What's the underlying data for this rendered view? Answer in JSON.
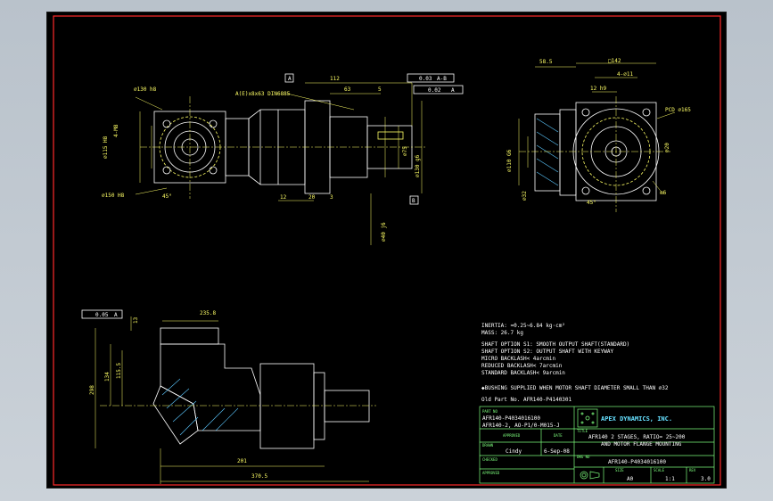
{
  "drawing": {
    "front_view": {
      "dims": {
        "d1": "⌀130 h8",
        "d2": "4-M8",
        "d3": "⌀115 H8",
        "d4": "⌀150 H8",
        "angle": "45°",
        "thread": "A(E)x8x63 DIN6885",
        "len1": "112",
        "len2": "63",
        "len3": "5",
        "len4": "12",
        "len5": "20",
        "len6": "3",
        "shaft1": "⌀75",
        "shaft2": "⌀130 g6",
        "shaft3": "⌀40 j6",
        "tol1": "0.03",
        "tol1_ref": "A-B",
        "tol2": "0.02",
        "tol2_ref": "A",
        "datum_a": "A",
        "datum_b": "B"
      }
    },
    "side_view": {
      "dims": {
        "s1": "58.5",
        "s2": "□142",
        "s3": "4-⌀11",
        "s4": "12 h9",
        "s5": "PCD ⌀165",
        "s6": "⌀110 G6",
        "s7": "⌀32",
        "s8": "⌀20",
        "s9": "45°",
        "s10": "⌀6"
      }
    },
    "bottom_view": {
      "dims": {
        "b1": "0.05",
        "b1_ref": "A",
        "b2": "235.8",
        "b3": "134",
        "b4": "115.5",
        "b5": "201",
        "b6": "370.5",
        "b7": "298",
        "b8": "13"
      }
    },
    "notes": [
      "INERTIA:   ≈0.25~6.84 kg·cm²",
      "MASS: 26.7 kg",
      "SHAFT OPTION S1: SMOOTH OUTPUT SHAFT(STANDARD)",
      "SHAFT OPTION S2: OUTPUT SHAFT WITH KEYWAY",
      "MICRO BACKLASH< 4arcmin",
      "REDUCED BACKLASH< 7arcmin",
      "STANDARD BACKLASH< 9arcmin",
      "◆BUSHING SUPPLIED WHEN MOTOR SHAFT DIAMETER SMALL THAN ⌀32",
      "Old Part No. AFR140-P4140301"
    ],
    "title_block": {
      "part_no_label": "PART NO",
      "part_no_1": "AFR140-P4034016100",
      "part_no_2": "AFR140-2, AO-P1/0-M015-J",
      "company": "APEX DYNAMICS, INC.",
      "title_label": "TITLE",
      "title_1": "AFR140 2 STAGES, RATIO= 25~200",
      "title_2": "AND MOTOR FLANGE MOUNTING",
      "approved_label": "APPROVED",
      "date_label": "DATE",
      "drawn_label": "DRAWN",
      "drawn_by": "Cindy",
      "date": "6-Sep-08",
      "dwg_no_label": "DWG NO",
      "dwg_no": "AFR140-P4034016100",
      "checked_label": "CHECKED",
      "approved2_label": "APPROVED",
      "size_label": "SIZE",
      "size": "A0",
      "scale_label": "SCALE",
      "scale": "1:1",
      "rev_label": "REV",
      "rev": "3.0"
    },
    "colors": {
      "frame": "#ff2a2a",
      "outline": "#ffffff",
      "dimension": "#ffff66",
      "hatch": "#5cc8ff",
      "title_block": "#7cfc7c"
    }
  }
}
